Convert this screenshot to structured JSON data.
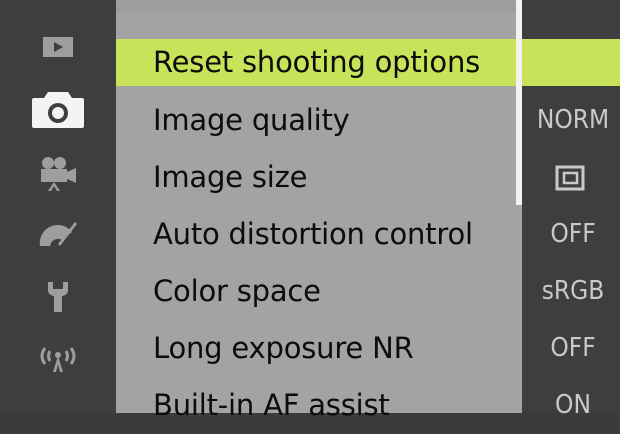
{
  "sidebar": {
    "items": [
      {
        "icon": "playback-icon"
      },
      {
        "icon": "camera-icon"
      },
      {
        "icon": "movie-camera-icon"
      },
      {
        "icon": "custom-settings-icon"
      },
      {
        "icon": "setup-wrench-icon"
      },
      {
        "icon": "network-icon"
      }
    ]
  },
  "menu": {
    "highlight_color": "#c8e35a",
    "items": [
      {
        "label": "Reset shooting options",
        "value": ""
      },
      {
        "label": "Image quality",
        "value": "NORM"
      },
      {
        "label": "Image size",
        "value": "",
        "value_icon": "image-size-large-icon"
      },
      {
        "label": "Auto distortion control",
        "value": "OFF"
      },
      {
        "label": "Color space",
        "value": "sRGB"
      },
      {
        "label": "Long exposure NR",
        "value": "OFF"
      },
      {
        "label": "Built-in AF assist",
        "value": "ON"
      }
    ]
  }
}
